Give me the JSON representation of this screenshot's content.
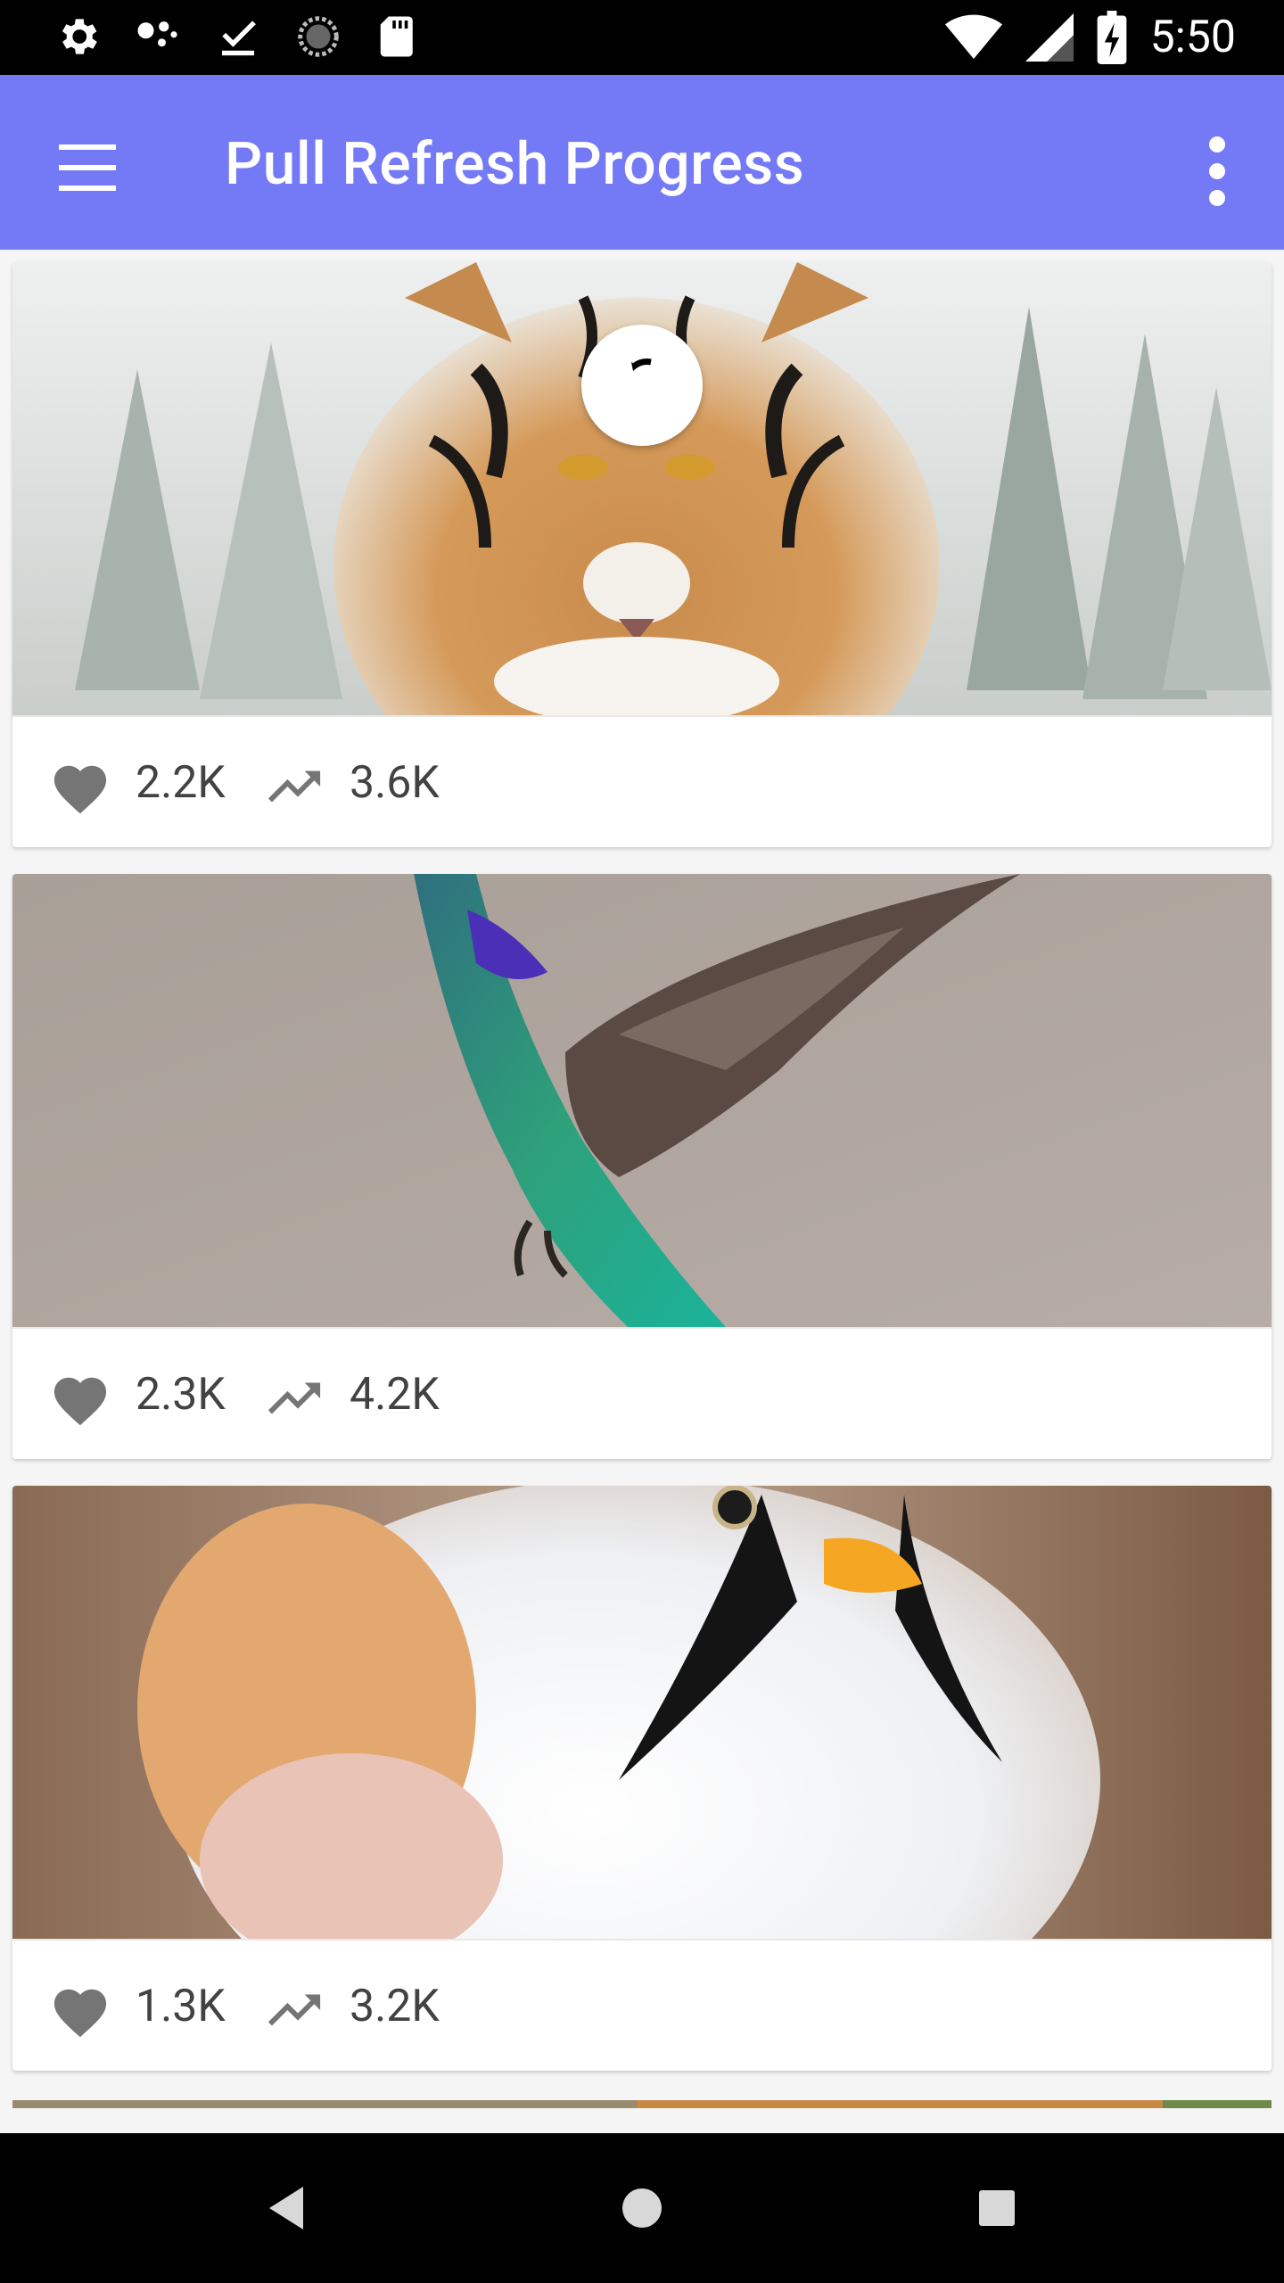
{
  "status_bar": {
    "time": "5:50",
    "left_icons": [
      "settings-icon",
      "assistant-dots-icon",
      "download-done-icon",
      "sync-circle-icon",
      "sd-card-icon"
    ],
    "right_icons": [
      "wifi-icon",
      "signal-icon",
      "battery-charging-icon"
    ]
  },
  "app_bar": {
    "title": "Pull Refresh Progress",
    "nav_icon": "menu-icon",
    "overflow_icon": "more-vert-icon"
  },
  "colors": {
    "primary": "#7479f5",
    "status_bar": "#000000",
    "background": "#f5f5f5",
    "icon_gray": "#757575",
    "text": "#424242"
  },
  "cards": [
    {
      "image": "tiger-in-snow",
      "likes": "2.2K",
      "trending": "3.6K"
    },
    {
      "image": "hummingbird",
      "likes": "2.3K",
      "trending": "4.2K"
    },
    {
      "image": "bearded-reedling-bird",
      "likes": "1.3K",
      "trending": "3.2K"
    }
  ],
  "nav_bar": {
    "icons": [
      "back-icon",
      "home-icon",
      "recents-icon"
    ]
  }
}
